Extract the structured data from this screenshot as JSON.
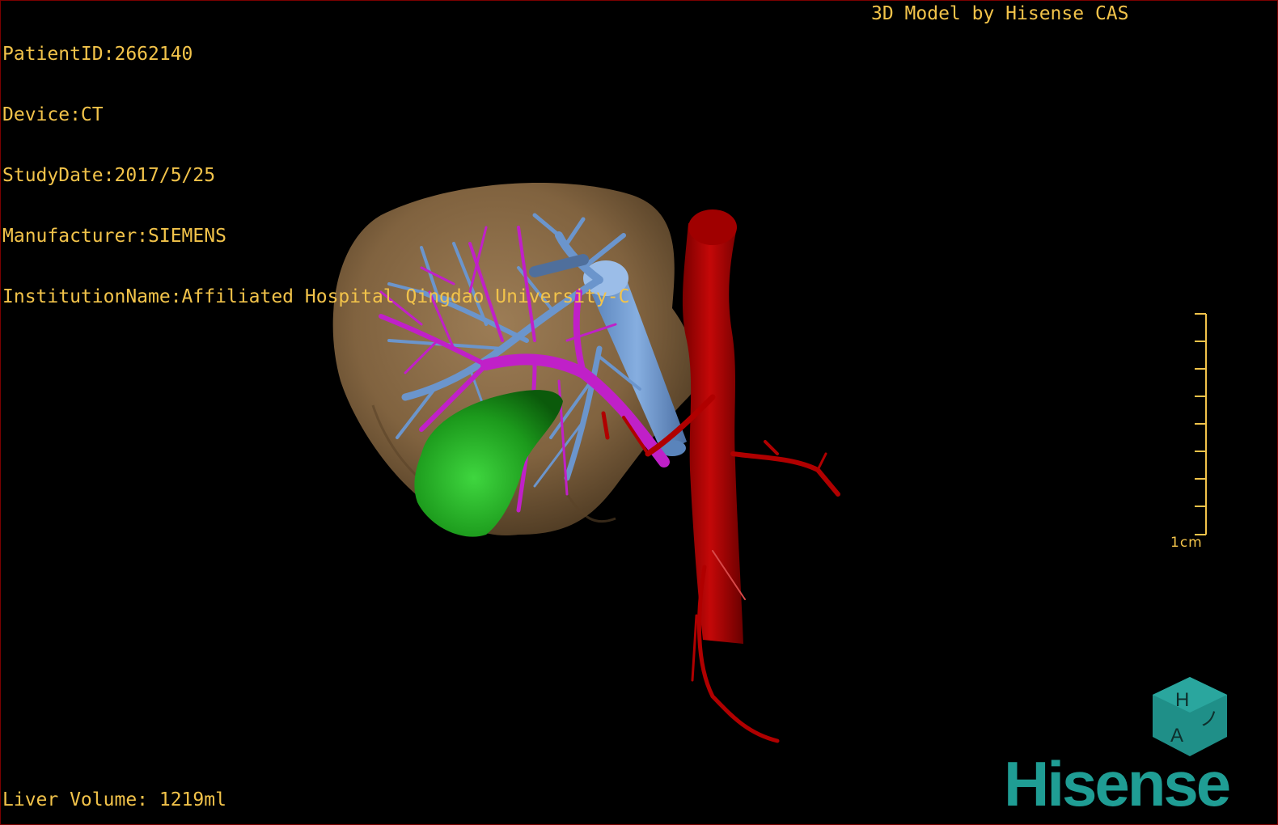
{
  "header": {
    "patient_id": "PatientID:2662140",
    "device": "Device:CT",
    "study_date": "StudyDate:2017/5/25",
    "manufacturer": "Manufacturer:SIEMENS",
    "institution": "InstitutionName:Affiliated Hospital Qingdao University-C"
  },
  "brand": {
    "title": "3D Model by Hisense CAS",
    "logo_word": "Hisense",
    "badge_letters": [
      "H",
      "A",
      "ノ"
    ]
  },
  "footer": {
    "liver_volume": "Liver Volume: 1219ml"
  },
  "scale": {
    "label": "1cm"
  },
  "colors": {
    "text": "#f2c34a",
    "liver": "#8a6a44",
    "hepatic_vein": "#6b95cc",
    "portal_vein": "#c020c8",
    "gallbladder": "#1c9a1c",
    "aorta": "#b00000",
    "brand_teal": "#1f9d94"
  },
  "icons": {
    "logo_badge": "hexagon-cube-icon"
  }
}
